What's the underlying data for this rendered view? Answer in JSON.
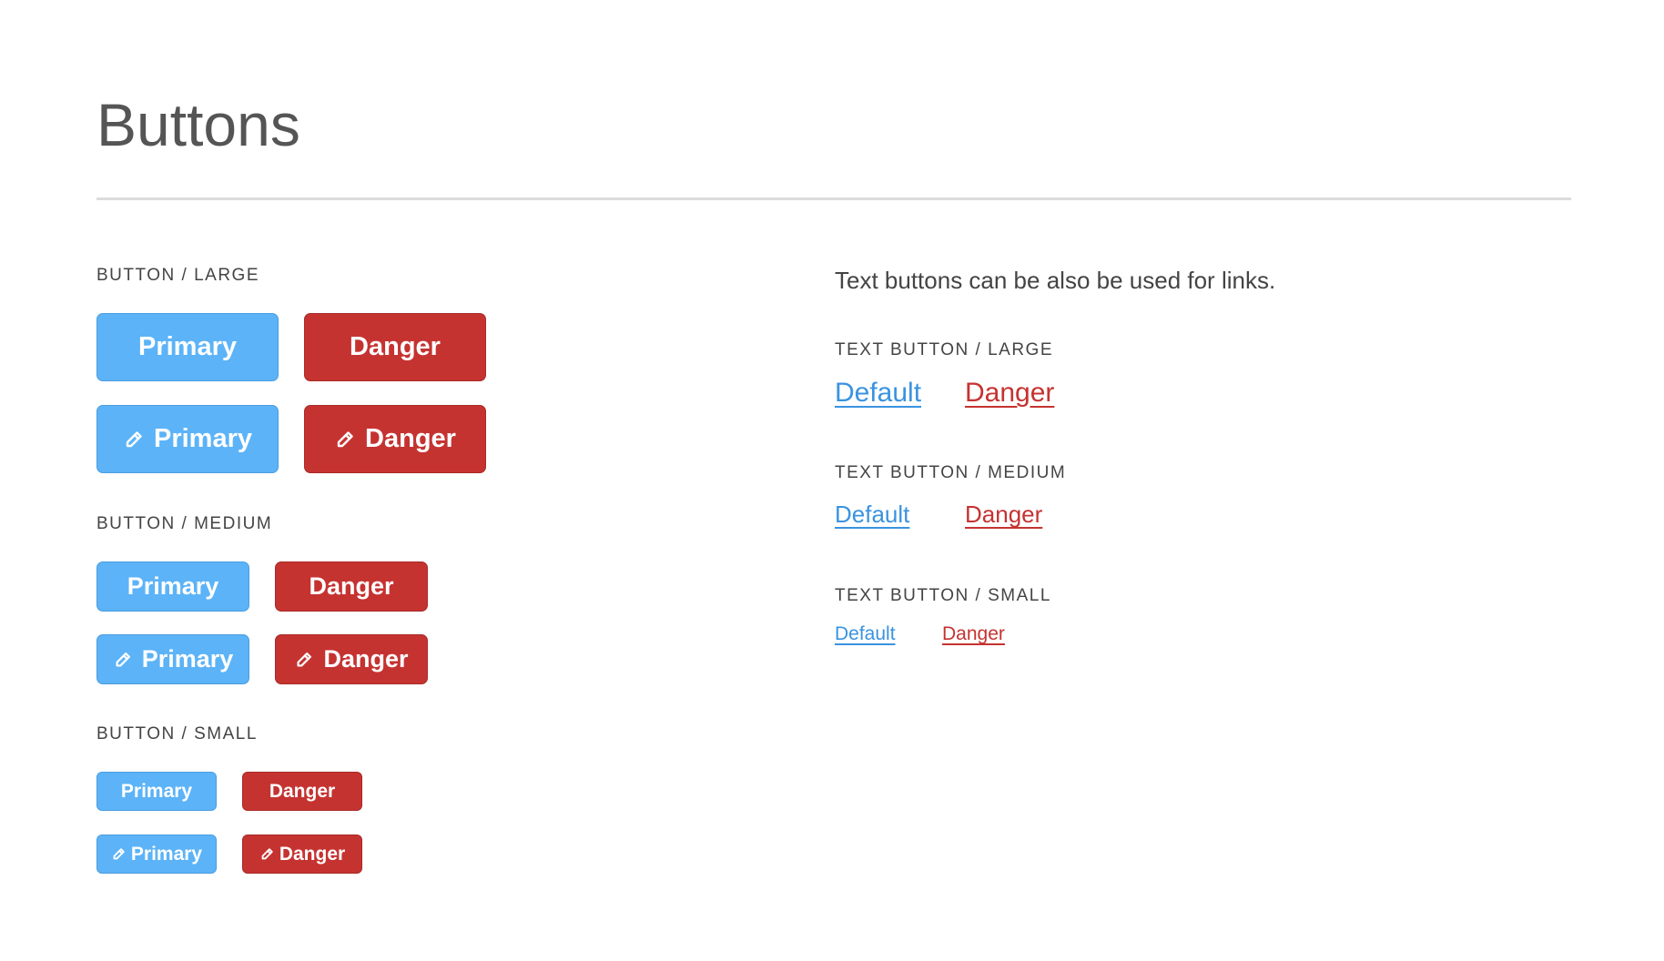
{
  "page": {
    "title": "Buttons"
  },
  "colors": {
    "primary": "#5cb3f7",
    "danger": "#c53331",
    "link_default": "#3a93e0",
    "link_danger": "#c53331"
  },
  "buttons": {
    "large": {
      "label": "BUTTON / LARGE",
      "primary": "Primary",
      "danger": "Danger",
      "primary_icon": "Primary",
      "danger_icon": "Danger"
    },
    "medium": {
      "label": "BUTTON / MEDIUM",
      "primary": "Primary",
      "danger": "Danger",
      "primary_icon": "Primary",
      "danger_icon": "Danger"
    },
    "small": {
      "label": "BUTTON / SMALL",
      "primary": "Primary",
      "danger": "Danger",
      "primary_icon": "Primary",
      "danger_icon": "Danger"
    },
    "icon": "pencil-icon"
  },
  "text_buttons": {
    "intro": "Text buttons can be also be used for links.",
    "large": {
      "label": "TEXT BUTTON / LARGE",
      "default": "Default",
      "danger": "Danger"
    },
    "medium": {
      "label": "TEXT BUTTON / MEDIUM",
      "default": "Default",
      "danger": "Danger"
    },
    "small": {
      "label": "TEXT BUTTON / SMALL",
      "default": "Default",
      "danger": "Danger"
    }
  }
}
